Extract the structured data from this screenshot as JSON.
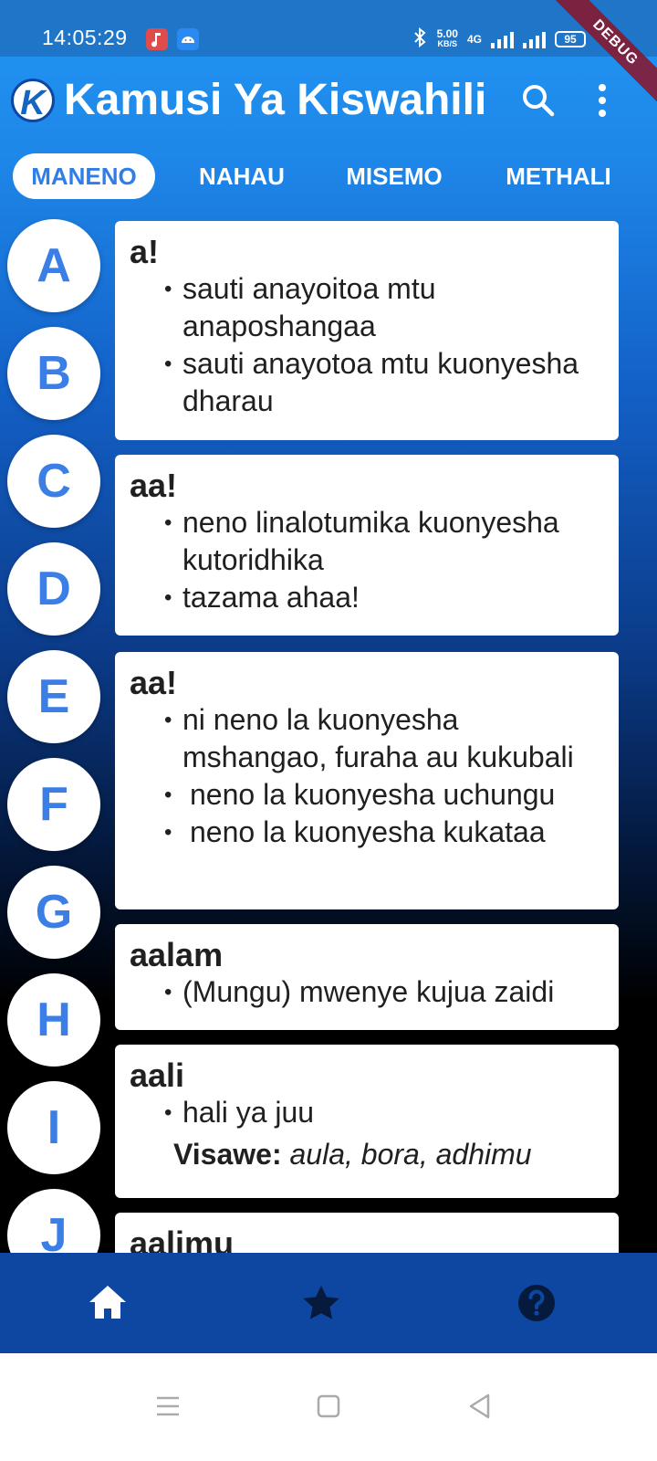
{
  "status_bar": {
    "time": "14:05:29",
    "speed_value": "5.00",
    "speed_unit": "KB/S",
    "network": "4G",
    "battery": "95",
    "debug_label": "DEBUG",
    "icons": [
      "music-notification-icon",
      "android-notification-icon",
      "bluetooth-icon",
      "signal-icon",
      "battery-icon"
    ]
  },
  "app_bar": {
    "logo_letter": "K",
    "title": "Kamusi Ya Kiswahili",
    "icons": [
      "search-icon",
      "more-vert-icon"
    ]
  },
  "tabs": [
    {
      "label": "MANENO",
      "active": true
    },
    {
      "label": "NAHAU",
      "active": false
    },
    {
      "label": "MISEMO",
      "active": false
    },
    {
      "label": "METHALI",
      "active": false
    }
  ],
  "letters": [
    "A",
    "B",
    "C",
    "D",
    "E",
    "F",
    "G",
    "H",
    "I",
    "J"
  ],
  "entries": [
    {
      "word": "a!",
      "definitions": [
        "sauti anayoitoa mtu anaposhangaa",
        "sauti anayotoa mtu kuonyesha dharau"
      ]
    },
    {
      "word": "aa!",
      "definitions": [
        "neno linalotumika kuonyesha kutoridhika",
        "tazama ahaa!"
      ]
    },
    {
      "word": "aa!",
      "definitions": [
        "ni neno la kuonyesha mshangao, furaha au kukubali",
        "neno la kuonyesha uchungu",
        "neno la kuonyesha kukataa"
      ]
    },
    {
      "word": "aalam",
      "definitions": [
        "(Mungu) mwenye kujua zaidi"
      ]
    },
    {
      "word": "aali",
      "definitions": [
        "hali ya juu"
      ],
      "synonyms_label": "Visawe:",
      "synonyms": "aula, bora, adhimu"
    },
    {
      "word": "aalimu",
      "definitions": []
    }
  ],
  "bottom_nav": {
    "items": [
      "home-icon",
      "star-icon",
      "help-icon"
    ],
    "active": "home"
  },
  "colors": {
    "accent": "#2196f3",
    "letter_text": "#3b7fe6",
    "bottom_nav": "#0d47a1"
  }
}
